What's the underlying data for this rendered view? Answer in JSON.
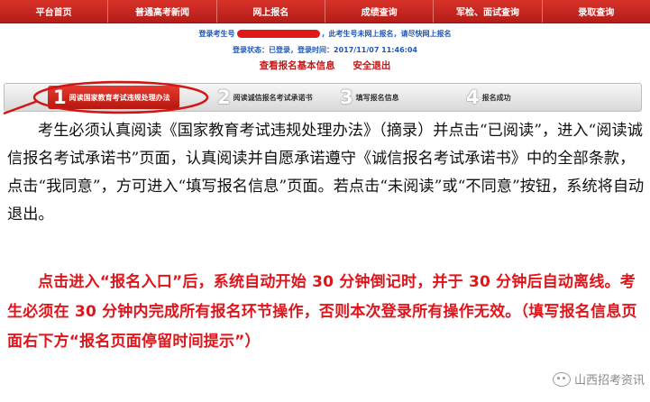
{
  "nav": {
    "items": [
      {
        "label": "平台首页"
      },
      {
        "label": "普通高考新闻"
      },
      {
        "label": "网上报名"
      },
      {
        "label": "成绩查询"
      },
      {
        "label": "军检、面试查询"
      },
      {
        "label": "录取查询"
      }
    ]
  },
  "login_info": {
    "line1_prefix": "登录考生号",
    "line1_suffix": "，此考生号未网上报名，请尽快网上报名",
    "line2": "登录状态：已登录，登录时间：2017/11/07 11:46:04",
    "view_info_link": "查看报名基本信息",
    "logout_link": "安全退出"
  },
  "steps": [
    {
      "num": "1",
      "label": "阅读国家教育考试违规处理办法"
    },
    {
      "num": "2",
      "label": "阅读诚信报名考试承诺书"
    },
    {
      "num": "3",
      "label": "填写报名信息"
    },
    {
      "num": "4",
      "label": "报名成功"
    }
  ],
  "body": {
    "paragraph_black": "考生必须认真阅读《国家教育考试违规处理办法》（摘录）并点击“已阅读”，进入“阅读诚信报名考试承诺书”页面，认真阅读并自愿承诺遵守《诚信报名考试承诺书》中的全部条款，点击“我同意”，方可进入“填写报名信息”页面。若点击“未阅读”或“不同意”按钮，系统将自动退出。",
    "paragraph_red": "点击进入“报名入口”后，系统自动开始 30 分钟倒记时，并于 30 分钟后自动离线。考生必须在 30 分钟内完成所有报名环节操作，否则本次登录所有操作无效。（填写报名信息页面右下方“报名页面停留时间提示”）"
  },
  "watermark": {
    "text": "山西招考资讯",
    "icon": "wechat-icon"
  },
  "colors": {
    "nav_red": "#c4241e",
    "info_blue": "#1f56b8",
    "alert_red": "#e0151b"
  }
}
